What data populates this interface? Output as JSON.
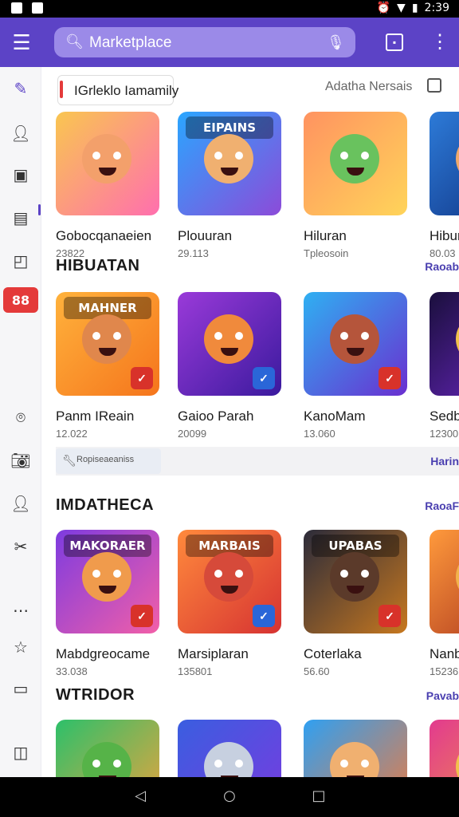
{
  "status_bar": {
    "time": "2:39"
  },
  "app_bar": {
    "search_text": "Marketplace",
    "search_icon": "search-icon",
    "mic_icon": "mic-icon",
    "menu_icon": "menu-icon",
    "more_icon": "more-vert-icon"
  },
  "colors": {
    "accent": "#5c43c6",
    "search_bg": "#9b8ae8",
    "rail_active": "#e43a3a"
  },
  "filter": {
    "chip_label": "IGrleklo Iamamily",
    "right_label": "Adatha Nersais"
  },
  "rows": [
    {
      "items": [
        {
          "name": "Gobocqanaeien",
          "meta": "23822",
          "bg": [
            "#f9c650",
            "#ff6fae"
          ],
          "face": "#f3a06b",
          "banner": ""
        },
        {
          "name": "Plouuran",
          "meta": "29.113",
          "bg": [
            "#2aa6ff",
            "#8c4bd9"
          ],
          "face": "#f0b070",
          "banner": "EIPAINS"
        },
        {
          "name": "Hiluran",
          "meta": "Tpleosoin",
          "bg": [
            "#ff9360",
            "#ffd45a"
          ],
          "face": "#69c25e",
          "banner": ""
        },
        {
          "name": "Hiburan",
          "meta": "80.03",
          "bg": [
            "#2d7bd8",
            "#0e2e7d"
          ],
          "face": "#f0a96c",
          "banner": ""
        }
      ]
    },
    {
      "title": "HIBUATAN",
      "link": "Raoab",
      "items": [
        {
          "name": "Panm IReain",
          "meta": "12.022",
          "bg": [
            "#ffb23c",
            "#f5751c"
          ],
          "face": "#e0874c",
          "banner": "MAHNER"
        },
        {
          "name": "Gaioo Parah",
          "meta": "20099",
          "bg": [
            "#9a3ad9",
            "#3a1a9e"
          ],
          "face": "#f08a3c",
          "banner": ""
        },
        {
          "name": "KanoMam",
          "meta": "13.060",
          "bg": [
            "#2fb0f2",
            "#6a2fd0"
          ],
          "face": "#b5553b",
          "banner": ""
        },
        {
          "name": "Sedb",
          "meta": "12300",
          "bg": [
            "#1a0f3c",
            "#6d27c8"
          ],
          "face": "#f2c24c",
          "banner": ""
        }
      ]
    },
    {
      "strip_label": "Ropiseaeaniss",
      "strip_link": "Harin",
      "title": "IMDATHECA",
      "link": "RaoaF",
      "items": [
        {
          "name": "Mabdgreocame",
          "meta": "33.038",
          "bg": [
            "#7d3be0",
            "#f25fa8"
          ],
          "face": "#f09b4c",
          "banner": "MAKORAER"
        },
        {
          "name": "Marsiplaran",
          "meta": "135801",
          "bg": [
            "#ff8a3c",
            "#d63232"
          ],
          "face": "#d64a3a",
          "banner": "MARBAIS"
        },
        {
          "name": "Coterlaka",
          "meta": "56.60",
          "bg": [
            "#2b2b3a",
            "#c7781f"
          ],
          "face": "#5b3a2a",
          "banner": "UPABAS"
        },
        {
          "name": "Nanb",
          "meta": "15236",
          "bg": [
            "#ff9a3c",
            "#a52f1c"
          ],
          "face": "#f2b24c",
          "banner": ""
        }
      ]
    },
    {
      "title": "WTRIDOR",
      "link": "Pavab",
      "items": [
        {
          "name": "",
          "meta": "",
          "bg": [
            "#2cc06a",
            "#f2a23c"
          ],
          "face": "#56b348",
          "banner": ""
        },
        {
          "name": "",
          "meta": "",
          "bg": [
            "#3a5ee0",
            "#7a3ae0"
          ],
          "face": "#c7d0e0",
          "banner": ""
        },
        {
          "name": "",
          "meta": "",
          "bg": [
            "#2fa0f2",
            "#f27a3c"
          ],
          "face": "#f0b070",
          "banner": ""
        },
        {
          "name": "",
          "meta": "",
          "bg": [
            "#e23a8f",
            "#f2a23c"
          ],
          "face": "#f2c24c",
          "banner": ""
        }
      ]
    }
  ],
  "rail": [
    {
      "icon": "grid-logo-icon"
    },
    {
      "icon": "user-outline-icon"
    },
    {
      "icon": "tablet-icon"
    },
    {
      "icon": "folder-icon"
    },
    {
      "icon": "contact-icon"
    },
    {
      "icon": "games-icon",
      "label": "88",
      "active": true
    },
    {
      "icon": "chat-icon"
    },
    {
      "icon": "camera-icon"
    },
    {
      "icon": "person-icon"
    },
    {
      "icon": "puzzle-icon"
    },
    {
      "icon": "more-horiz-icon"
    },
    {
      "icon": "star-icon"
    },
    {
      "icon": "file-icon"
    },
    {
      "icon": "account-icon"
    }
  ]
}
